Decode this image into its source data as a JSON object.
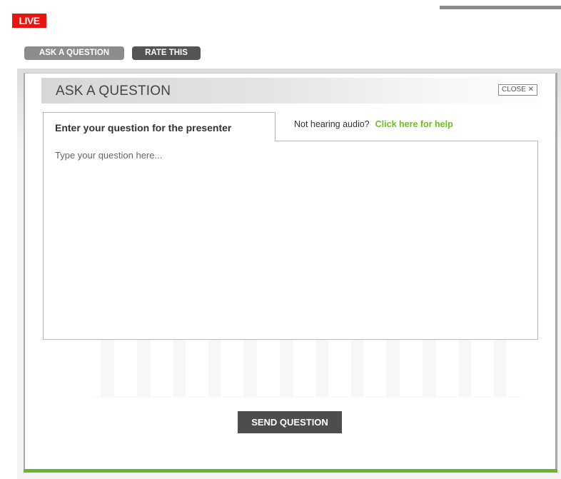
{
  "badge": {
    "live": "LIVE"
  },
  "tabs": {
    "ask": "ASK A QUESTION",
    "rate": "RATE THIS"
  },
  "modal": {
    "title": "ASK A QUESTION",
    "close": "CLOSE ✕",
    "tab_label": "Enter your question for the presenter",
    "audio_prompt": "Not hearing audio?",
    "help_link": "Click here for help",
    "placeholder": "Type your question here...",
    "send": "SEND QUESTION"
  },
  "colors": {
    "live": "#e81410",
    "accent": "#66b72e",
    "link": "#6cc21b"
  }
}
